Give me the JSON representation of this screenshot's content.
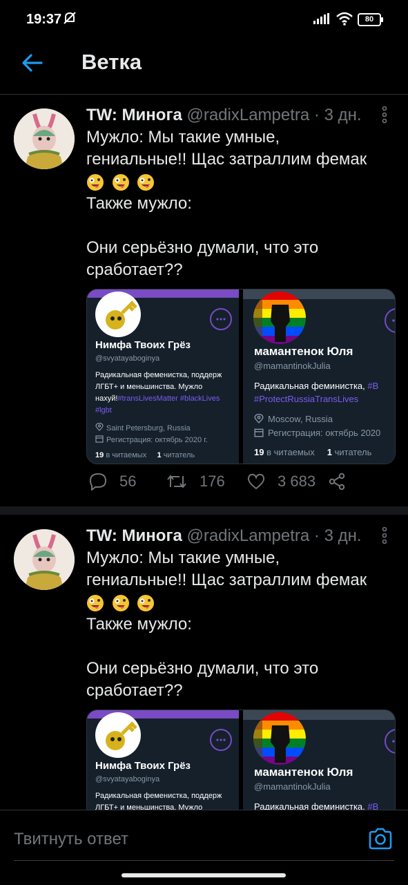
{
  "status_bar": {
    "time": "19:37",
    "battery": "80"
  },
  "header": {
    "title": "Ветка"
  },
  "tweets": [
    {
      "name": "TW: Минога",
      "handle": "@radixLampetra",
      "dot": "·",
      "time": "3 дн.",
      "line1": "Мужло: Мы такие умные,",
      "line2": "гениальные!! Щас затраллим фемак",
      "line4": "Также мужло:",
      "line6": "Они серьёзно думали, что это",
      "line7": "сработает??",
      "replies": "56",
      "retweets": "176",
      "likes": "3 683",
      "cards": {
        "left": {
          "name": "Нимфа Твоих Грёз",
          "handle": "@svyatayaboginya",
          "bio1": "Радикальная феменистка, поддерж",
          "bio2": "ЛГБТ+ и меньшинства. Мужло",
          "bio3_text": "нахуй!",
          "bio3_tags": "#transLivesMatter #blackLives",
          "bio4_tags": "#lgbt",
          "location": "Saint Petersburg, Russia",
          "joined": "Регистрация: октябрь 2020 г.",
          "following_count": "19",
          "following_label": "в читаемых",
          "followers_count": "1",
          "followers_label": "читатель"
        },
        "right": {
          "name": "мамантенок Юля",
          "handle": "@mamantinokJulia",
          "bio1_text": "Радикальная феминистка, ",
          "bio1_tag": "#B",
          "bio2_tags": "#ProtectRussiaTransLives",
          "location": "Moscow, Russia",
          "joined": "Регистрация: октябрь 2020",
          "following_count": "19",
          "following_label": "в читаемых",
          "followers_count": "1",
          "followers_label": "читатель"
        }
      }
    },
    {
      "name": "TW: Минога",
      "handle": "@radixLampetra",
      "dot": "·",
      "time": "3 дн.",
      "line1": "Мужло: Мы такие умные,",
      "line2": "гениальные!! Щас затраллим фемак",
      "line4": "Также мужло:",
      "line6": "Они серьёзно думали, что это",
      "line7": "сработает??",
      "cards": {
        "left": {
          "name": "Нимфа Твоих Грёз",
          "handle": "@svyatayaboginya",
          "bio1": "Радикальная феменистка, поддерж",
          "bio2": "ЛГБТ+ и меньшинства. Мужло"
        },
        "right": {
          "name": "мамантенок Юля",
          "handle": "@mamantinokJulia",
          "bio1_text": "Радикальная феминистка, ",
          "bio1_tag": "#B"
        }
      }
    }
  ],
  "reply": {
    "placeholder": "Твитнуть ответ"
  },
  "colors": {
    "accent": "#1d9bf0",
    "card_link": "#7d5cf1",
    "muted": "#71767b"
  },
  "icons": {
    "back": "arrow-left-icon",
    "more": "more-vertical-icon",
    "reply": "reply-icon",
    "retweet": "retweet-icon",
    "like": "heart-icon",
    "share": "share-icon",
    "camera": "camera-icon"
  }
}
